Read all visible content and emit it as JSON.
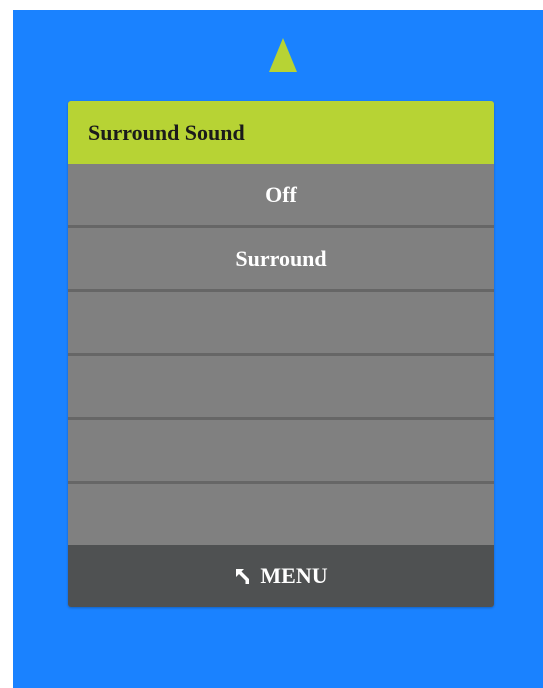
{
  "header": {
    "title": "Surround Sound"
  },
  "options": [
    {
      "label": "Off"
    },
    {
      "label": "Surround"
    },
    {
      "label": ""
    },
    {
      "label": ""
    },
    {
      "label": ""
    },
    {
      "label": ""
    }
  ],
  "footer": {
    "back_icon": "back-arrow-icon",
    "label": "MENU"
  },
  "colors": {
    "background": "#1a82ff",
    "accent": "#b7d334",
    "panel": "#808080",
    "footer": "#4f5152"
  }
}
